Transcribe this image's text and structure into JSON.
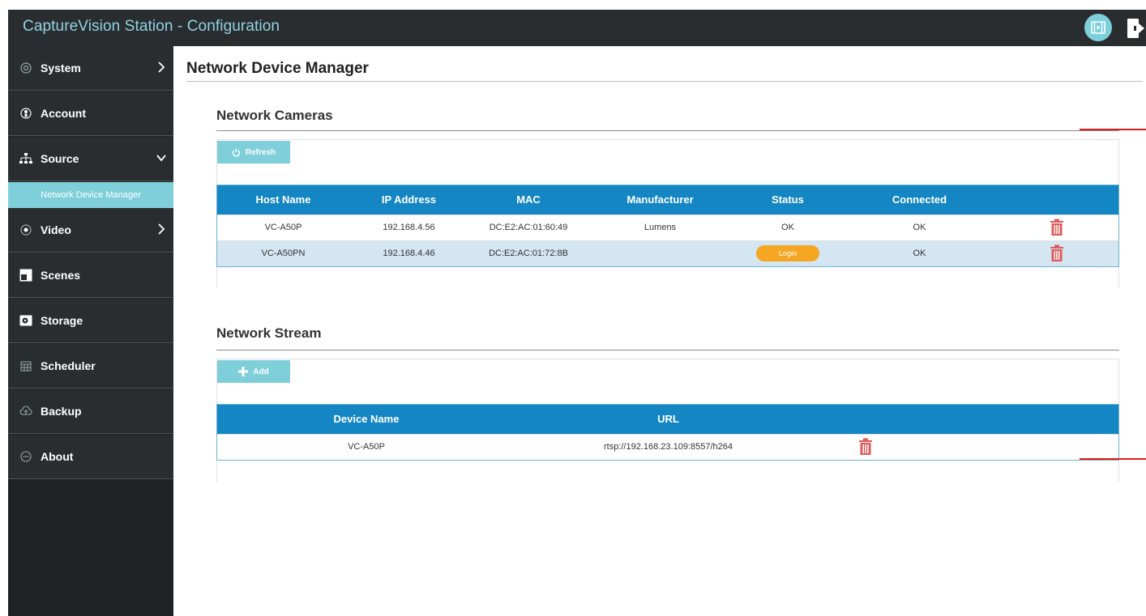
{
  "app": {
    "title": "CaptureVision Station - Configuration"
  },
  "sidebar": {
    "items": [
      {
        "label": "System",
        "icon": "target-icon",
        "chevron": "right"
      },
      {
        "label": "Account",
        "icon": "user-circle-icon",
        "chevron": ""
      },
      {
        "label": "Source",
        "icon": "network-tree-icon",
        "chevron": "down"
      },
      {
        "label": "Video",
        "icon": "radio-dot-icon",
        "chevron": "right"
      },
      {
        "label": "Scenes",
        "icon": "scenes-window-icon",
        "chevron": ""
      },
      {
        "label": "Storage",
        "icon": "storage-drive-icon",
        "chevron": ""
      },
      {
        "label": "Scheduler",
        "icon": "calendar-icon",
        "chevron": ""
      },
      {
        "label": "Backup",
        "icon": "cloud-upload-icon",
        "chevron": ""
      },
      {
        "label": "About",
        "icon": "ellipsis-circle-icon",
        "chevron": ""
      }
    ],
    "sub_item": "Network Device Manager"
  },
  "main": {
    "page_title": "Network Device Manager",
    "cameras": {
      "title": "Network Cameras",
      "refresh_label": "Refresh",
      "columns": [
        "Host Name",
        "IP Address",
        "MAC",
        "Manufacturer",
        "Status",
        "Connected"
      ],
      "rows": [
        {
          "host": "VC-A50P",
          "ip": "192.168.4.56",
          "mac": "DC:E2:AC:01:60:49",
          "manufacturer": "Lumens",
          "status": "OK",
          "connected": "OK"
        },
        {
          "host": "VC-A50PN",
          "ip": "192.168.4.46",
          "mac": "DC:E2:AC:01:72:8B",
          "manufacturer": "",
          "status_button": "Login",
          "connected": "OK"
        }
      ]
    },
    "stream": {
      "title": "Network Stream",
      "add_label": "Add",
      "columns": [
        "Device Name",
        "URL"
      ],
      "rows": [
        {
          "device": "VC-A50P",
          "url": "rtsp://192.168.23.109:8557/h264"
        }
      ]
    }
  },
  "colors": {
    "titlebar": "#2a2d30",
    "accent": "#7fcfdb",
    "table_header": "#1586c4",
    "login": "#f5a623",
    "trash": "#e05a5a",
    "annotation": "#e41b1b"
  }
}
